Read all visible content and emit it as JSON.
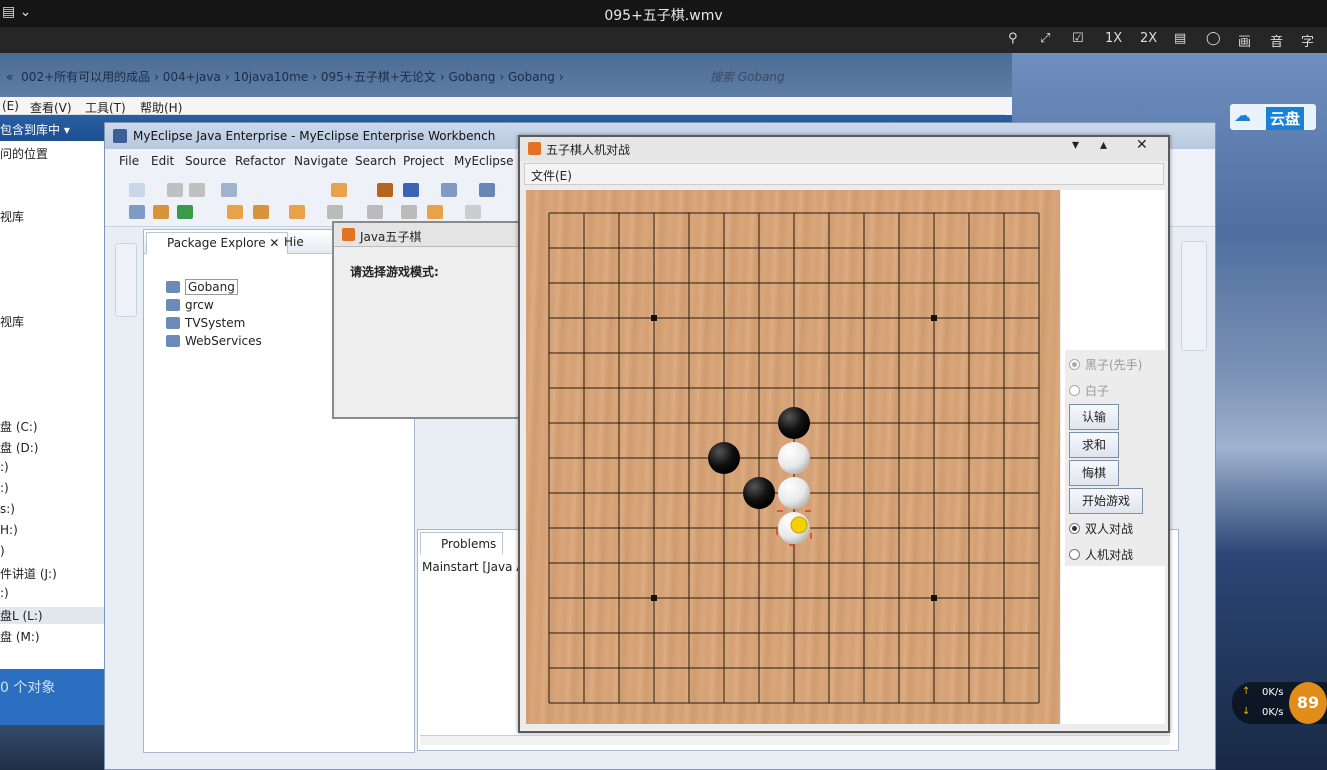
{
  "player": {
    "title": "095+五子棋.wmv",
    "controls": [
      "1X",
      "2X",
      "画",
      "音",
      "字"
    ]
  },
  "explorer": {
    "breadcrumb": [
      "«",
      "002+所有可以用的成品",
      "004+java",
      "10java10me",
      "095+五子棋+无论文",
      "Gobang",
      "Gobang"
    ],
    "search_placeholder": "搜索 Gobang",
    "menu": [
      "(E)",
      "查看(V)",
      "工具(T)",
      "帮助(H)"
    ],
    "toolbar_label": "包含到库中 ▾",
    "nav_items": [
      "问的位置",
      "视库",
      "视库",
      "盘 (C:)",
      "盘 (D:)",
      ":)",
      ":)",
      "s:)",
      "H:)",
      ")",
      "件讲道 (J:)",
      ":)",
      "盘L (L:)",
      "盘 (M:)"
    ],
    "status": "0 个对象"
  },
  "eclipse": {
    "title": "MyEclipse Java Enterprise - MyEclipse Enterprise Workbench",
    "menu": [
      "File",
      "Edit",
      "Source",
      "Refactor",
      "Navigate",
      "Search",
      "Project",
      "MyEclipse"
    ],
    "package_tab": "Package Explore",
    "package_tab2": "Hie",
    "projects": [
      "Gobang",
      "grcw",
      "TVSystem",
      "WebServices"
    ],
    "problems_tab": "Problems",
    "console_line": "Mainstart [Java Ap"
  },
  "dialog": {
    "title": "Java五子棋",
    "message": "请选择游戏模式:"
  },
  "gobang": {
    "title": "五子棋人机对战",
    "menu_file": "文件(E)",
    "radio_black": "黑子(先手)",
    "radio_white": "白子",
    "btn_surrender": "认输",
    "btn_draw": "求和",
    "btn_undo": "悔棋",
    "btn_start": "开始游戏",
    "radio_pvp": "双人对战",
    "radio_pve": "人机对战",
    "board_size": 15,
    "star_points": [
      [
        3,
        3
      ],
      [
        3,
        11
      ],
      [
        11,
        3
      ],
      [
        11,
        11
      ]
    ],
    "stones": [
      {
        "col": 7,
        "row": 6,
        "color": "black"
      },
      {
        "col": 5,
        "row": 7,
        "color": "black"
      },
      {
        "col": 7,
        "row": 7,
        "color": "white"
      },
      {
        "col": 6,
        "row": 8,
        "color": "black"
      },
      {
        "col": 7,
        "row": 8,
        "color": "white"
      },
      {
        "col": 7,
        "row": 9,
        "color": "white",
        "last": true
      }
    ]
  },
  "tray": {
    "cloud": "云盘",
    "up": "0K/s",
    "down": "0K/s",
    "badge": "89"
  }
}
